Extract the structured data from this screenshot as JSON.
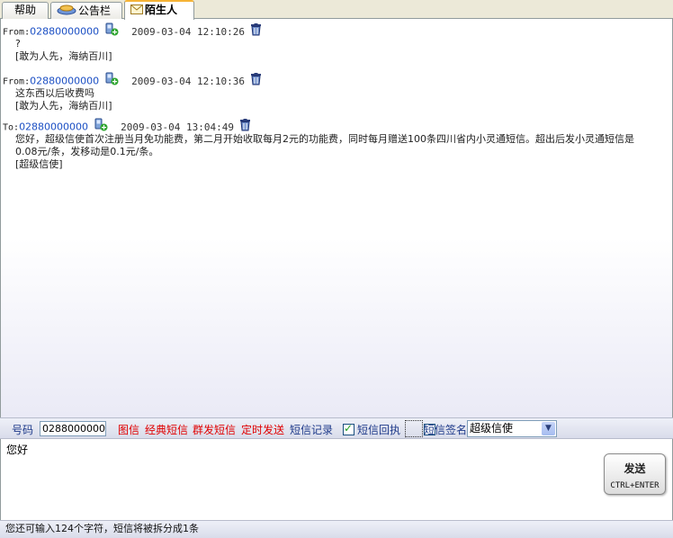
{
  "tabs": [
    {
      "label": "帮助"
    },
    {
      "label": "公告栏"
    },
    {
      "label": "陌生人",
      "active": true
    }
  ],
  "messages": [
    {
      "direction": "From:",
      "number": "02880000000",
      "time": "2009-03-04 12:10:26",
      "body": "?",
      "signature": "[敢为人先，海纳百川]"
    },
    {
      "direction": "From:",
      "number": "02880000000",
      "time": "2009-03-04 12:10:36",
      "body": "这东西以后收费吗",
      "signature": "[敢为人先，海纳百川]"
    },
    {
      "direction": "To:",
      "number": "02880000000",
      "time": "2009-03-04 13:04:49",
      "body": "您好，超级信使首次注册当月免功能费，第二月开始收取每月2元的功能费，同时每月赠送100条四川省内小灵通短信。超出后发小灵通短信是0.08元/条，发移动是0.1元/条。",
      "signature": "[超级信使]"
    }
  ],
  "toolbar": {
    "number_label": "号码",
    "number_value": "02880000000",
    "links": [
      "图信",
      "经典短信",
      "群发短信",
      "定时发送"
    ],
    "history_label": "短信记录",
    "receipt_label": "短信回执",
    "receipt_checked": true,
    "signature_label": "短信签名",
    "signature_checked": false,
    "signature_value": "超级信使"
  },
  "compose": {
    "text": "您好",
    "send_label": "发送",
    "send_shortcut": "CTRL+ENTER"
  },
  "status": {
    "text": "您还可输入124个字符，短信将被拆分成1条"
  },
  "colors": {
    "link_red": "#e00000",
    "number_blue": "#1b4fc4",
    "tab_highlight": "#f5b335"
  }
}
